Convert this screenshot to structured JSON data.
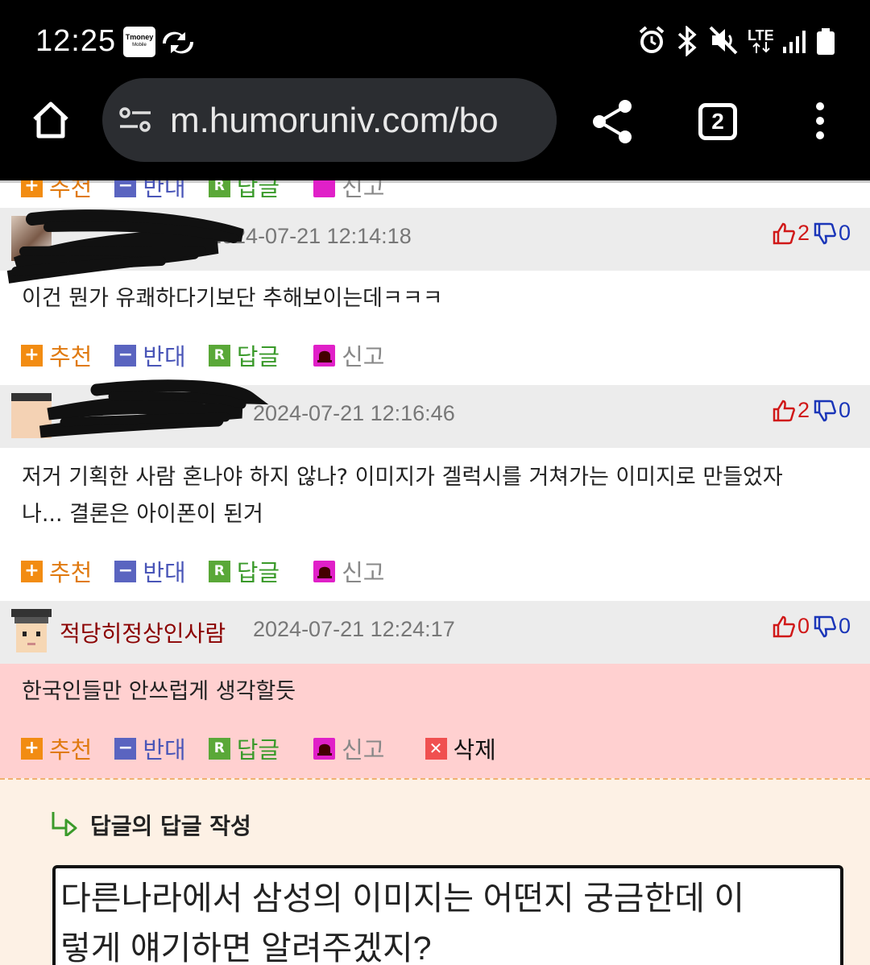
{
  "status_bar": {
    "time": "12:25",
    "tmoney_label": "Tmoney",
    "tmoney_sub": "Mobile",
    "network": "LTE"
  },
  "browser": {
    "url": "m.humoruniv.com/bo",
    "tab_count": "2"
  },
  "actions": {
    "recommend": "추천",
    "oppose": "반대",
    "reply": "답글",
    "report": "신고",
    "delete": "삭제",
    "reply_icon": "R"
  },
  "comments": [
    {
      "nickname": "",
      "date": "2024-07-21 12:14:18",
      "up": "2",
      "down": "0",
      "body": "이건 뭔가 유쾌하다기보단 추해보이는데ㅋㅋㅋ"
    },
    {
      "nickname": "",
      "date": "2024-07-21 12:16:46",
      "up": "2",
      "down": "0",
      "body_line1": "저거 기획한 사람 혼나야 하지 않나? 이미지가 겔럭시를 거쳐가는 이미지로 만들었자",
      "body_line2": "나... 결론은 아이폰이 된거"
    },
    {
      "nickname": "적당히정상인사람",
      "date": "2024-07-21 12:24:17",
      "up": "0",
      "down": "0",
      "body": "한국인들만 안쓰럽게 생각할듯"
    }
  ],
  "reply_form": {
    "title": "답글의 답글 작성",
    "text_line1": "다른나라에서 삼성의 이미지는 어떤지 궁금한데 이",
    "text_line2": "렇게 얘기하면 알려주겠지?"
  },
  "colors": {
    "nickname": "#8b0000",
    "vote_up": "#d01818",
    "vote_down": "#1a35b8",
    "highlight_bg": "#ffd0d0",
    "reply_bg": "#fdf1e5"
  }
}
